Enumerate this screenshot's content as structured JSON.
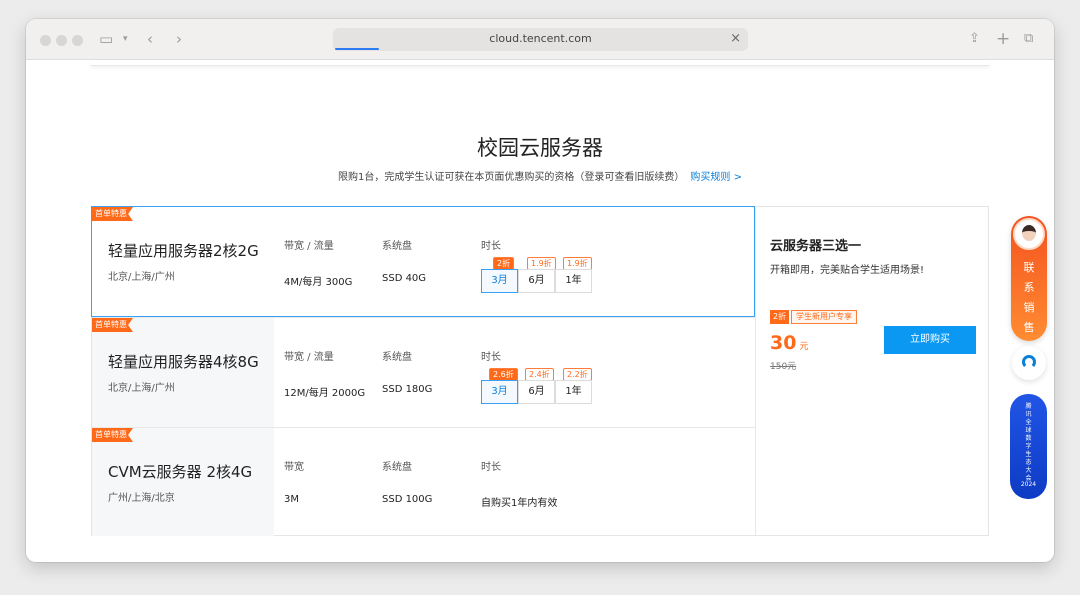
{
  "browser": {
    "url": "cloud.tencent.com"
  },
  "page": {
    "title": "校园云服务器",
    "subtitle": "限购1台，完成学生认证可获在本页面优惠购买的资格（登录可查看旧版续费）",
    "rules_link": "购买规则 >"
  },
  "products": [
    {
      "tag": "首单特惠",
      "name": "轻量应用服务器2核2G",
      "region": "北京/上海/广州",
      "bandwidth_label": "带宽 / 流量",
      "bandwidth_value": "4M/每月 300G",
      "disk_label": "系统盘",
      "disk_value": "SSD 40G",
      "duration_label": "时长",
      "durations": [
        {
          "label": "3月",
          "discount": "2折"
        },
        {
          "label": "6月",
          "discount": "1.9折"
        },
        {
          "label": "1年",
          "discount": "1.9折"
        }
      ]
    },
    {
      "tag": "首单特惠",
      "name": "轻量应用服务器4核8G",
      "region": "北京/上海/广州",
      "bandwidth_label": "带宽 / 流量",
      "bandwidth_value": "12M/每月 2000G",
      "disk_label": "系统盘",
      "disk_value": "SSD 180G",
      "duration_label": "时长",
      "durations": [
        {
          "label": "3月",
          "discount": "2.6折"
        },
        {
          "label": "6月",
          "discount": "2.4折"
        },
        {
          "label": "1年",
          "discount": "2.2折"
        }
      ]
    },
    {
      "tag": "首单特惠",
      "name": "CVM云服务器 2核4G",
      "region": "广州/上海/北京",
      "bandwidth_label": "带宽",
      "bandwidth_value": "3M",
      "disk_label": "系统盘",
      "disk_value": "SSD 100G",
      "duration_label": "时长",
      "duration_value": "自购买1年内有效"
    }
  ],
  "side": {
    "title": "云服务器三选一",
    "desc": "开箱即用，完美贴合学生适用场景!",
    "discount_tag": "2折",
    "user_tag": "学生新用户专享",
    "price": "30",
    "price_unit": "元",
    "old_price": "150元",
    "buy_label": "立即购买"
  },
  "floating": {
    "sales_label": "联系销售",
    "banner_text": "腾讯全球数字生态大会",
    "banner_year": "2024"
  },
  "colors": {
    "accent_blue": "#0a98f2",
    "accent_orange": "#ff6a1a"
  }
}
